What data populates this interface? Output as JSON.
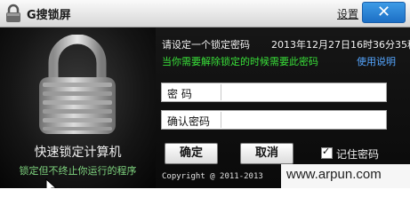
{
  "window": {
    "title": "G搜锁屏",
    "settings_label": "设置",
    "close_label": "✕",
    "accent_color": "#1d6fc5"
  },
  "left_panel": {
    "caption": "快速锁定计算机",
    "subcaption": "锁定但不终止你运行的程序",
    "icon": "padlock-icon"
  },
  "form": {
    "prompt": "请设定一个锁定密码",
    "datetime": "2013年12月27日16时36分35秒",
    "hint": "当你需要解除锁定的时候需要此密码",
    "help_link": "使用说明",
    "password_label": "密  码",
    "password_value": "",
    "confirm_label": "确认密码",
    "confirm_value": "",
    "ok_label": "确定",
    "cancel_label": "取消",
    "remember_label": "记住密码",
    "remember_checked": true,
    "copyright": "Copyright @ 2011-2013"
  },
  "watermark": {
    "text": "www.arpun.com"
  }
}
